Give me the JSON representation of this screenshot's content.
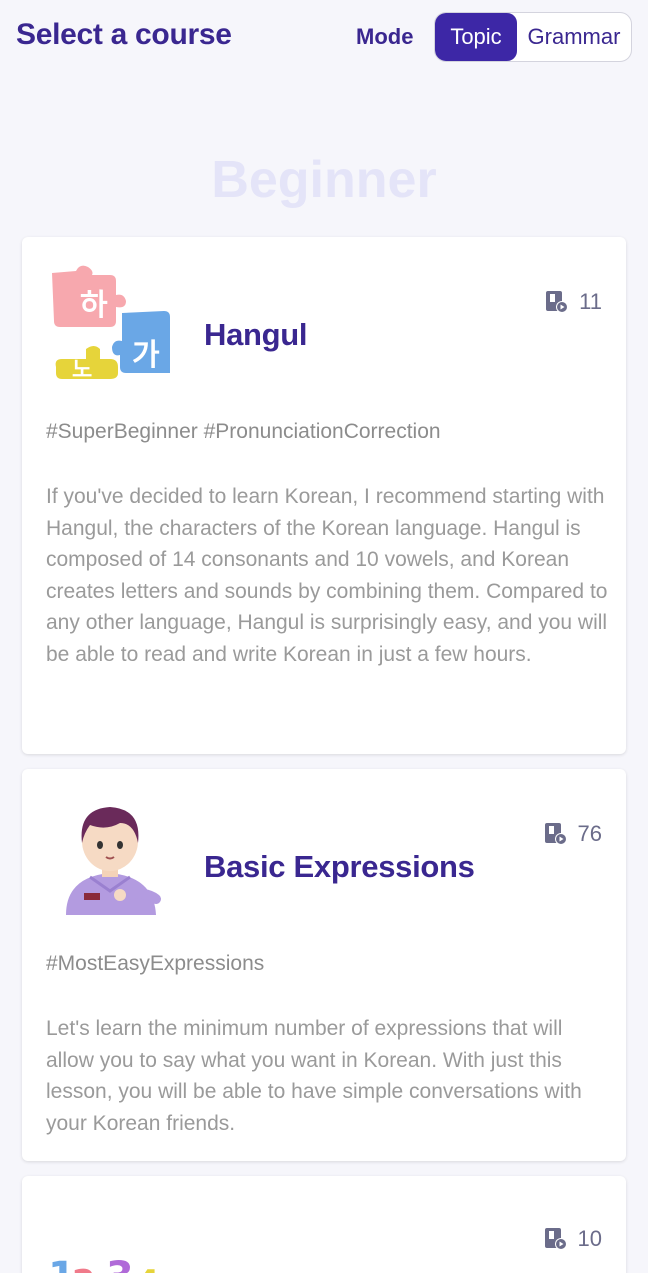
{
  "header": {
    "title": "Select a course",
    "mode_label": "Mode",
    "mode_options": [
      "Topic",
      "Grammar"
    ],
    "selected_mode": "Topic"
  },
  "level": "Beginner",
  "courses": [
    {
      "title": "Hangul",
      "lesson_count": "11",
      "tags": "#SuperBeginner #PronunciationCorrection",
      "description": "If you've decided to learn Korean, I recommend starting with Hangul, the characters of the Korean language. Hangul is composed of 14 consonants and 10 vowels, and Korean creates letters and sounds by combining them. Compared to any other language, Hangul is surprisingly easy, and you will be able to read and write Korean in just a few hours.",
      "icon": "hangul-puzzle-icon"
    },
    {
      "title": "Basic Expressions",
      "lesson_count": "76",
      "tags": "#MostEasyExpressions",
      "description": "Let's learn the minimum number of expressions that will allow you to say what you want in Korean. With just this lesson, you will be able to have simple conversations with your Korean friends.",
      "icon": "student-character-icon"
    },
    {
      "title": "",
      "lesson_count": "10",
      "icon": "numbers-icon"
    }
  ],
  "colors": {
    "accent": "#3d27a6",
    "title": "#3a2790",
    "muted_text": "#9a9a9a",
    "background": "#f6f6fb"
  }
}
